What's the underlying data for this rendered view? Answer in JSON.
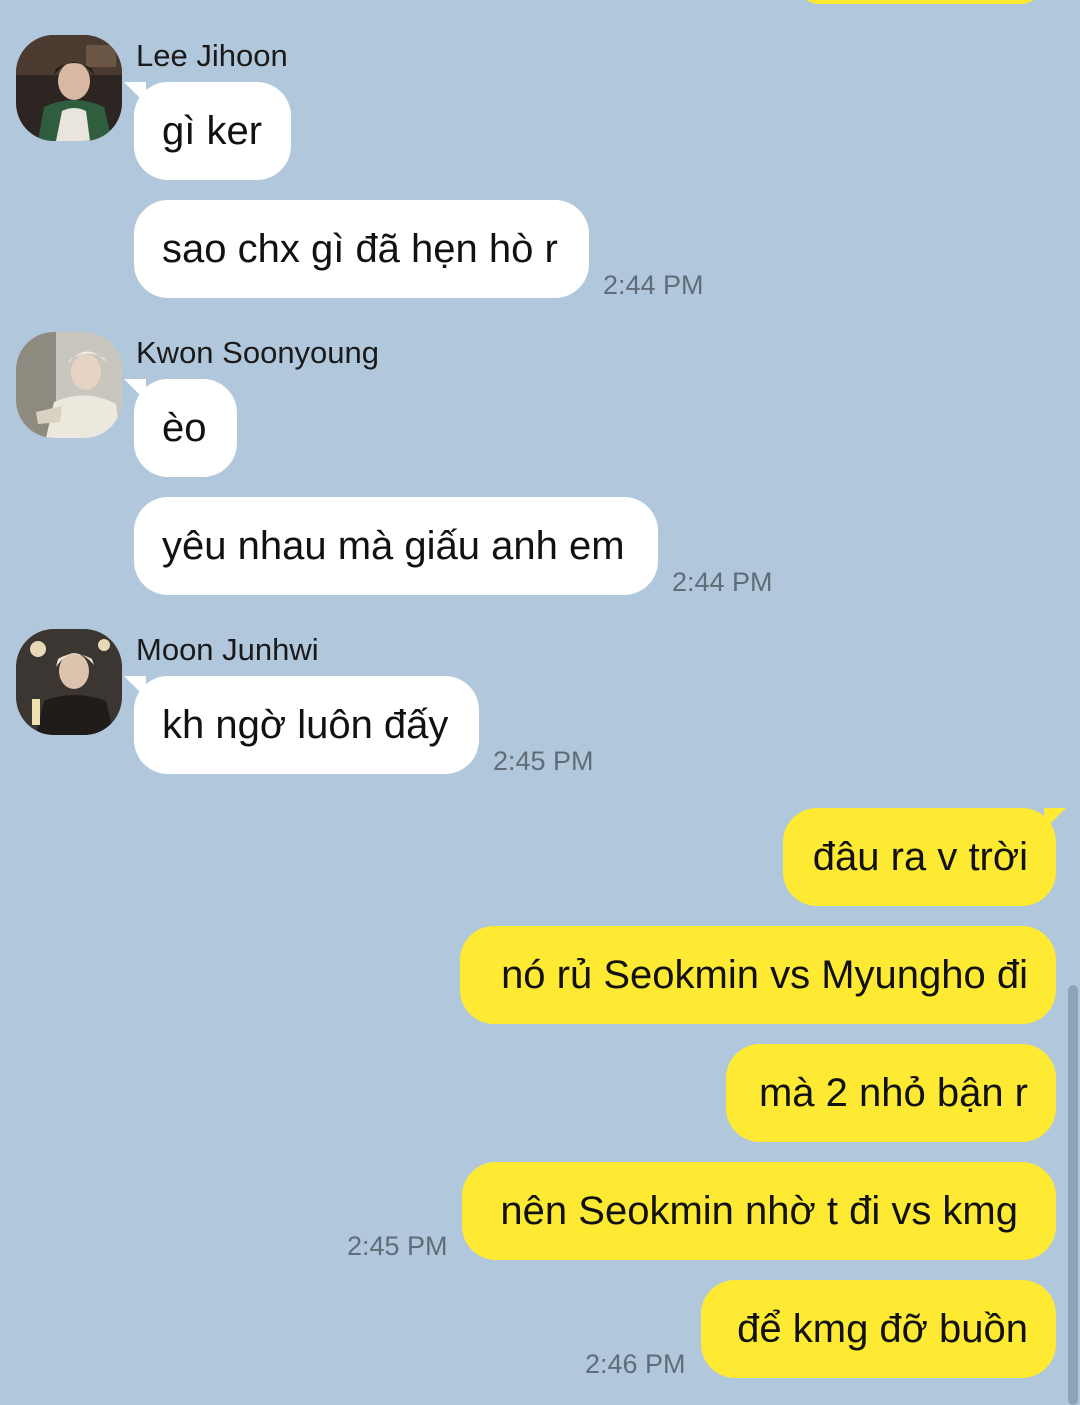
{
  "groups": [
    {
      "sender": "Lee Jihoon",
      "avatar_icon": "profile-photo",
      "messages": [
        {
          "text": "gì ker"
        },
        {
          "text": "sao chx gì đã hẹn hò r",
          "time": "2:44 PM"
        }
      ]
    },
    {
      "sender": "Kwon Soonyoung",
      "avatar_icon": "profile-photo",
      "messages": [
        {
          "text": "èo"
        },
        {
          "text": "yêu nhau mà giấu anh em",
          "time": "2:44 PM"
        }
      ]
    },
    {
      "sender": "Moon Junhwi",
      "avatar_icon": "profile-photo",
      "messages": [
        {
          "text": "kh ngờ luôn đấy",
          "time": "2:45 PM"
        }
      ]
    }
  ],
  "outgoing": [
    {
      "text": "đâu ra v trời"
    },
    {
      "text": "nó rủ Seokmin vs Myungho đi"
    },
    {
      "text": "mà 2 nhỏ bận r"
    },
    {
      "text": "nên Seokmin nhờ t đi vs kmg",
      "time": "2:45 PM"
    },
    {
      "text": "để kmg đỡ buồn",
      "time": "2:46 PM"
    }
  ],
  "colors": {
    "background": "#b1c8dc",
    "incoming_bubble": "#ffffff",
    "outgoing_bubble": "#fee933",
    "timestamp": "#5f6d79"
  }
}
